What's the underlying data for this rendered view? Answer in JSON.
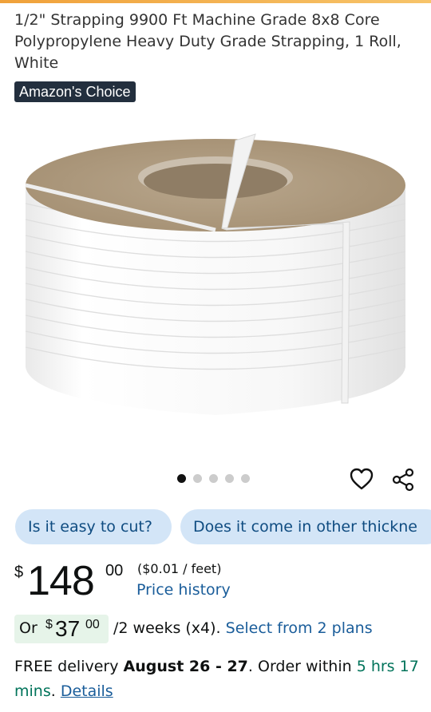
{
  "product": {
    "title": "1/2\" Strapping 9900 Ft Machine Grade 8x8 Core Polypropylene Heavy Duty Grade Strapping, 1 Roll, White",
    "badge": "Amazon's Choice",
    "image_icon": "strapping-roll-image",
    "image_count": 5,
    "image_active_index": 0
  },
  "actions": {
    "wishlist_icon": "heart-icon",
    "share_icon": "share-icon"
  },
  "questions": [
    "Is it easy to cut?",
    "Does it come in other thickne"
  ],
  "price": {
    "currency": "$",
    "whole": "148",
    "fraction": "00",
    "unit_price": "($0.01 / feet)",
    "history_link": "Price history"
  },
  "installment": {
    "prefix": "Or",
    "currency": "$",
    "whole": "37",
    "fraction": "00",
    "term": "/2 weeks (x4).",
    "link": "Select from 2 plans"
  },
  "delivery": {
    "free_text": "FREE delivery",
    "dates": "August 26 - 27",
    "order_within": ". Order within",
    "countdown": "5 hrs 17 mins",
    "period": ".",
    "details_link": "Details"
  },
  "colors": {
    "accent_link": "#1a5d9a",
    "badge_bg": "#232f3e",
    "chip_bg": "#d3e5f7",
    "installment_bg": "#e6f4e9",
    "countdown": "#00735a"
  }
}
